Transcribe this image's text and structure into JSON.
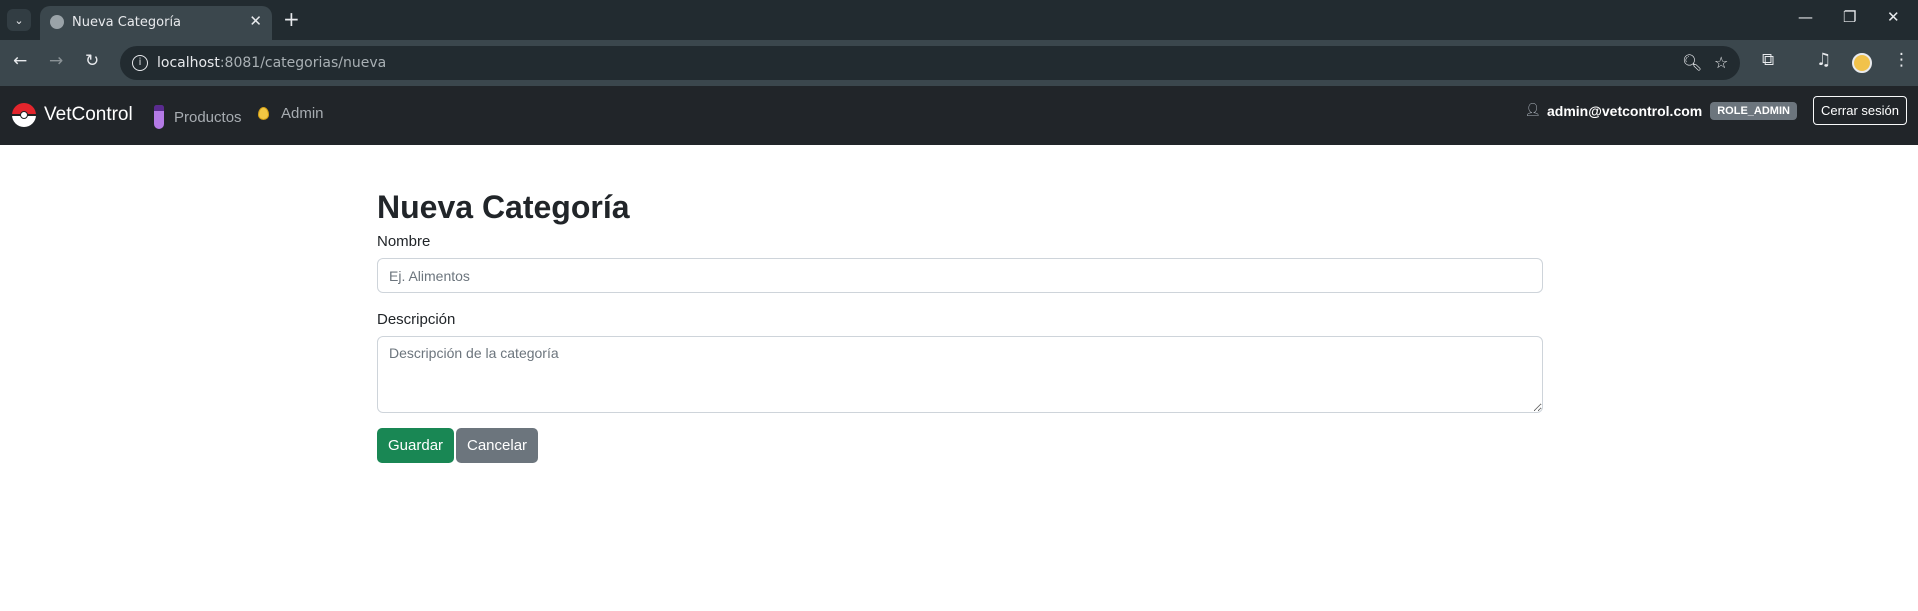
{
  "browser": {
    "tab_title": "Nueva Categoría",
    "url_host": "localhost",
    "url_rest": ":8081/categorias/nueva",
    "icons": [
      "tab-search-icon",
      "globe-icon",
      "close-icon",
      "new-tab-icon",
      "back-icon",
      "forward-icon",
      "reload-icon",
      "site-info-icon",
      "zoom-icon",
      "bookmark-star-icon",
      "extensions-icon",
      "media-icon",
      "profile-avatar",
      "menu-icon",
      "minimize-icon",
      "restore-icon",
      "window-close-icon"
    ]
  },
  "navbar": {
    "brand": "VetControl",
    "links": [
      {
        "label": "Productos",
        "icon": "potion-icon"
      },
      {
        "label": "Admin",
        "icon": "egg-icon"
      }
    ],
    "user_email": "admin@vetcontrol.com",
    "role": "ROLE_ADMIN",
    "logout_label": "Cerrar sesión"
  },
  "form": {
    "title": "Nueva Categoría",
    "name_label": "Nombre",
    "name_value": "",
    "name_placeholder": "Ej. Alimentos",
    "description_label": "Descripción",
    "description_value": "",
    "description_placeholder": "Descripción de la categoría",
    "save_label": "Guardar",
    "cancel_label": "Cancelar"
  },
  "colors": {
    "navbar_bg": "#212529",
    "save_button": "#198754",
    "cancel_button": "#6c757d",
    "chrome_dark": "#222b30",
    "chrome_toolbar": "#3b474d"
  }
}
